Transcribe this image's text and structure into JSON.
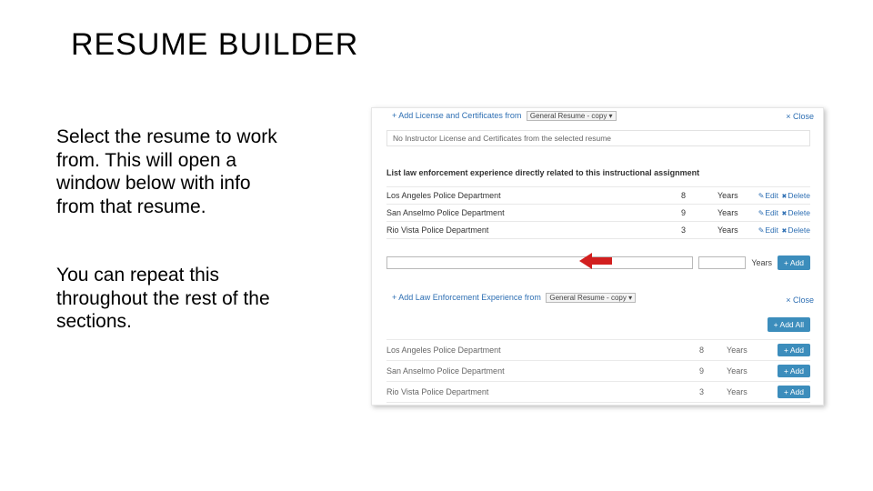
{
  "title": "RESUME BUILDER",
  "para1": "Select the resume to work from. This will open a window below with info from that resume.",
  "para2": "You can repeat this throughout the rest of the sections.",
  "shot": {
    "close_label": "× Close",
    "add_license_label": "+ Add License and Certificates from",
    "resume_select_label": "General Resume - copy ▾",
    "no_instructor_msg": "No Instructor License and Certificates from the selected resume",
    "instruction_text": "List law enforcement experience directly related to this instructional assignment",
    "edit_label": "Edit",
    "delete_label": "Delete",
    "years_label": "Years",
    "add_btn": "+ Add",
    "add_all_btn": "+ Add All",
    "add_btn_small": "+ Add",
    "add_law_label": "+ Add Law Enforcement Experience from",
    "resume_select_label2": "General Resume - copy ▾",
    "rows": [
      {
        "name": "Los Angeles Police Department",
        "n": "8",
        "years": "Years"
      },
      {
        "name": "San Anselmo Police Department",
        "n": "9",
        "years": "Years"
      },
      {
        "name": "Rio Vista Police Department",
        "n": "3",
        "years": "Years"
      }
    ],
    "new_entry_placeholder": "",
    "rows2": [
      {
        "name": "Los Angeles Police Department",
        "n": "8",
        "years": "Years"
      },
      {
        "name": "San Anselmo Police Department",
        "n": "9",
        "years": "Years"
      },
      {
        "name": "Rio Vista Police Department",
        "n": "3",
        "years": "Years"
      }
    ]
  }
}
